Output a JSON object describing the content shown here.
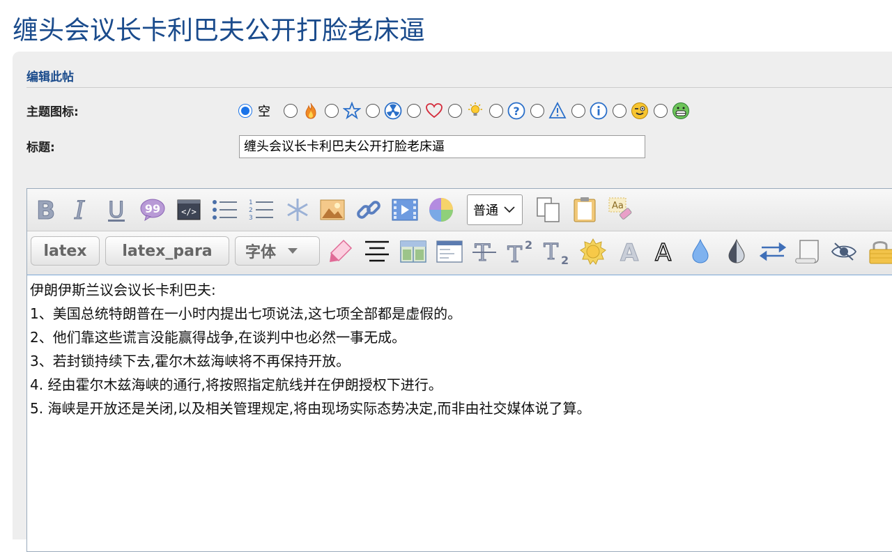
{
  "page": {
    "title": "缠头会议长卡利巴夫公开打脸老床逼"
  },
  "form": {
    "section_title": "编辑此帖",
    "icon_label": "主题图标:",
    "title_label": "标题:",
    "title_value": "缠头会议长卡利巴夫公开打脸老床逼",
    "icon_options": [
      {
        "text": "空",
        "icon": "none",
        "selected": true
      },
      {
        "icon": "fire-icon",
        "selected": false
      },
      {
        "icon": "star-icon",
        "selected": false
      },
      {
        "icon": "radioactive-icon",
        "selected": false
      },
      {
        "icon": "heart-icon",
        "selected": false
      },
      {
        "icon": "lightbulb-icon",
        "selected": false
      },
      {
        "icon": "question-icon",
        "selected": false
      },
      {
        "icon": "warning-icon",
        "selected": false
      },
      {
        "icon": "info-icon",
        "selected": false
      },
      {
        "icon": "wink-face-icon",
        "selected": false
      },
      {
        "icon": "grin-face-icon",
        "selected": false
      }
    ]
  },
  "toolbar": {
    "font_size_select": "普通",
    "latex_label": "latex",
    "latex_para_label": "latex_para",
    "font_label": "字体"
  },
  "editor": {
    "lines": [
      "伊朗伊斯兰议会议长卡利巴夫:",
      "1、美国总统特朗普在一小时内提出七项说法,这七项全部都是虚假的。",
      "2、他们靠这些谎言没能赢得战争,在谈判中也必然一事无成。",
      "3、若封锁持续下去,霍尔木兹海峡将不再保持开放。",
      "4. 经由霍尔木兹海峡的通行,将按照指定航线并在伊朗授权下进行。",
      "5. 海峡是开放还是关闭,以及相关管理规定,将由现场实际态势决定,而非由社交媒体说了算。"
    ]
  },
  "colors": {
    "accent": "#1a4b8c",
    "radio_selected": "#1a73e8"
  }
}
